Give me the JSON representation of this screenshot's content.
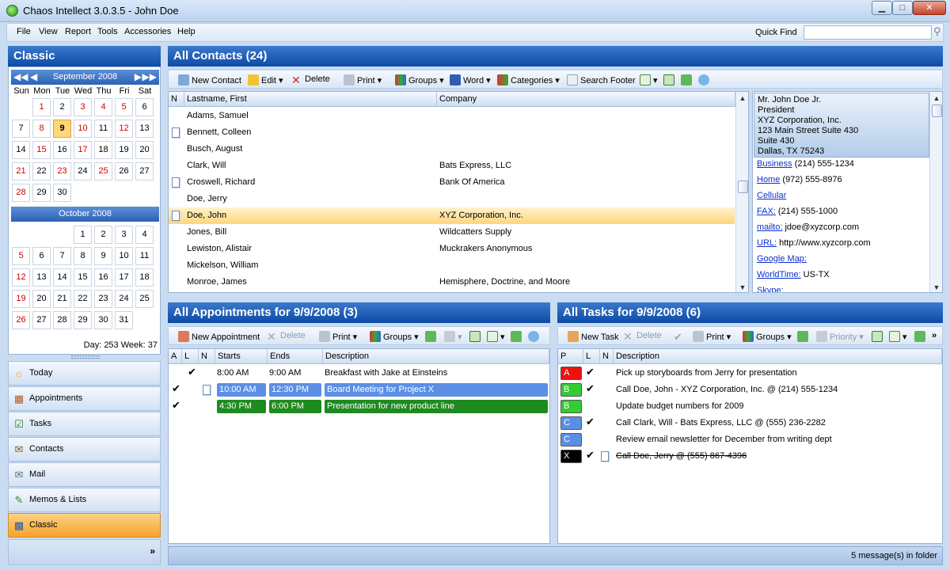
{
  "window": {
    "title": "Chaos Intellect 3.0.3.5 - John Doe",
    "min_label": "▁",
    "max_label": "□",
    "close_label": "✕"
  },
  "menu": {
    "items": [
      "File",
      "View",
      "Report",
      "Tools",
      "Accessories",
      "Help"
    ],
    "quick_find_label": "Quick Find",
    "quick_find_value": ""
  },
  "left": {
    "header": "Classic",
    "cal1": {
      "month": "September 2008",
      "dow": [
        "Sun",
        "Mon",
        "Tue",
        "Wed",
        "Thu",
        "Fri",
        "Sat"
      ],
      "rows": [
        [
          "",
          "1",
          "2",
          "3",
          "4",
          "5",
          "6"
        ],
        [
          "7",
          "8",
          "9",
          "10",
          "11",
          "12",
          "13"
        ],
        [
          "14",
          "15",
          "16",
          "17",
          "18",
          "19",
          "20"
        ],
        [
          "21",
          "22",
          "23",
          "24",
          "25",
          "26",
          "27"
        ],
        [
          "28",
          "29",
          "30",
          "",
          "",
          "",
          ""
        ]
      ]
    },
    "cal2": {
      "month": "October 2008",
      "rows": [
        [
          "",
          "",
          "",
          "1",
          "2",
          "3",
          "4"
        ],
        [
          "5",
          "6",
          "7",
          "8",
          "9",
          "10",
          "11"
        ],
        [
          "12",
          "13",
          "14",
          "15",
          "16",
          "17",
          "18"
        ],
        [
          "19",
          "20",
          "21",
          "22",
          "23",
          "24",
          "25"
        ],
        [
          "26",
          "27",
          "28",
          "29",
          "30",
          "31",
          ""
        ]
      ]
    },
    "red_days_sep": [
      "1",
      "3",
      "4",
      "5",
      "8",
      "10",
      "12",
      "15",
      "17",
      "21",
      "23",
      "25",
      "28"
    ],
    "red_days_oct": [
      "5",
      "12",
      "19",
      "26"
    ],
    "today": "9",
    "day_week": "Day: 253  Week: 37",
    "nav": [
      "Today",
      "Appointments",
      "Tasks",
      "Contacts",
      "Mail",
      "Memos & Lists",
      "Classic"
    ],
    "nav_icons": [
      "sun-icon",
      "appointments-icon",
      "tasks-icon",
      "contacts-icon",
      "mail-icon",
      "memos-icon",
      "classic-icon"
    ]
  },
  "contacts": {
    "header": "All Contacts (24)",
    "toolbar": [
      "New Contact",
      "Edit",
      "Delete",
      "Print",
      "Groups",
      "Word",
      "Categories",
      "Search Footer"
    ],
    "columns": [
      "N",
      "Lastname, First",
      "Company"
    ],
    "rows": [
      {
        "name": "Adams, Samuel",
        "company": "",
        "note": false
      },
      {
        "name": "Bennett, Colleen",
        "company": "",
        "note": true
      },
      {
        "name": "Busch, August",
        "company": "",
        "note": false
      },
      {
        "name": "Clark, Will",
        "company": "Bats Express, LLC",
        "note": false
      },
      {
        "name": "Croswell, Richard",
        "company": "Bank Of America",
        "note": true
      },
      {
        "name": "Doe, Jerry",
        "company": "",
        "note": false
      },
      {
        "name": "Doe, John",
        "company": "XYZ Corporation, Inc.",
        "note": true
      },
      {
        "name": "Jones, Bill",
        "company": "Wildcatters Supply",
        "note": false
      },
      {
        "name": "Lewiston, Alistair",
        "company": "Muckrakers Anonymous",
        "note": false
      },
      {
        "name": "Mickelson, William",
        "company": "",
        "note": false
      },
      {
        "name": "Monroe, James",
        "company": "Hemisphere, Doctrine, and Moore",
        "note": false
      }
    ],
    "selected_index": 6
  },
  "detail": {
    "address": [
      "Mr. John Doe Jr.",
      "President",
      "XYZ Corporation, Inc.",
      "123 Main Street Suite 430",
      "Suite 430",
      "Dallas, TX 75243"
    ],
    "lines": [
      {
        "label": "Business",
        "value": " (214) 555-1234"
      },
      {
        "label": "Home",
        "value": " (972) 555-8976"
      },
      {
        "label": "Cellular",
        "value": ""
      },
      {
        "label": "FAX:",
        "value": " (214) 555-1000"
      },
      {
        "label": "mailto:",
        "value": " jdoe@xyzcorp.com"
      },
      {
        "label": "URL:",
        "value": " http://www.xyzcorp.com"
      },
      {
        "label": "Google Map:",
        "value": ""
      },
      {
        "label": "WorldTime:",
        "value": " US-TX"
      },
      {
        "label": "Skype:",
        "value": ""
      }
    ]
  },
  "appointments": {
    "header": "All Appointments for 9/9/2008 (3)",
    "toolbar": [
      "New Appointment",
      "Delete",
      "Print",
      "Groups"
    ],
    "columns": [
      "A",
      "L",
      "N",
      "Starts",
      "Ends",
      "Description"
    ],
    "rows": [
      {
        "a": "",
        "l": "✔",
        "n": false,
        "start": "8:00 AM",
        "end": "9:00 AM",
        "desc": "Breakfast with Jake at Einsteins",
        "color": ""
      },
      {
        "a": "✔",
        "l": "",
        "n": true,
        "start": "10:00 AM",
        "end": "12:30 PM",
        "desc": "Board Meeting for Project X",
        "color": "#5b8fe6"
      },
      {
        "a": "✔",
        "l": "",
        "n": false,
        "start": "4:30 PM",
        "end": "6:00 PM",
        "desc": "Presentation for new product line",
        "color": "#1f8a1f"
      }
    ]
  },
  "tasks": {
    "header": "All Tasks for 9/9/2008 (6)",
    "toolbar": [
      "New Task",
      "Delete",
      "Print",
      "Groups",
      "Priority"
    ],
    "columns": [
      "P",
      "L",
      "N",
      "Description"
    ],
    "rows": [
      {
        "p": "A",
        "color": "#ee1111",
        "l": "✔",
        "n": false,
        "desc": "Pick up storyboards from Jerry for presentation",
        "done": false
      },
      {
        "p": "B",
        "color": "#33cc33",
        "l": "✔",
        "n": false,
        "desc": "Call Doe, John - XYZ Corporation, Inc. @ (214) 555-1234",
        "done": false
      },
      {
        "p": "B",
        "color": "#33cc33",
        "l": "",
        "n": false,
        "desc": "Update budget numbers for 2009",
        "done": false
      },
      {
        "p": "C",
        "color": "#5b8fe6",
        "l": "✔",
        "n": false,
        "desc": "Call Clark, Will - Bats Express, LLC @ (555) 236-2282",
        "done": false
      },
      {
        "p": "C",
        "color": "#5b8fe6",
        "l": "",
        "n": false,
        "desc": "Review email newsletter for December from writing dept",
        "done": false
      },
      {
        "p": "X",
        "color": "#000000",
        "l": "✔",
        "n": true,
        "desc": "Call Doe, Jerry @ (555) 867-4396",
        "done": true
      }
    ]
  },
  "status": {
    "text": "5 message(s) in folder"
  }
}
